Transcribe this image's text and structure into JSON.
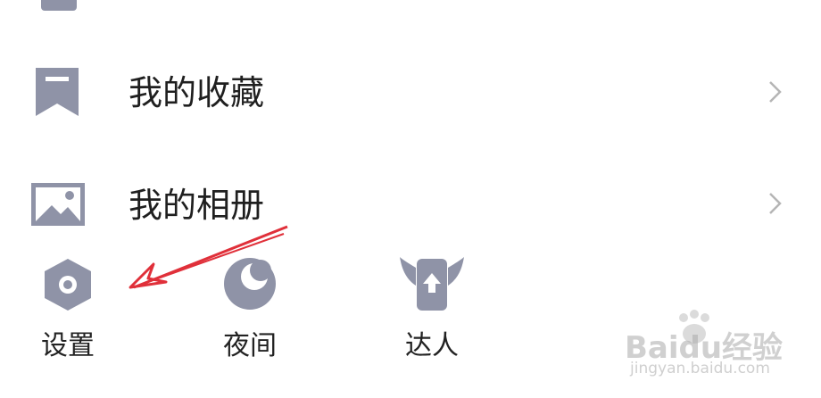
{
  "menu": {
    "items": [
      {
        "label": "我的收藏",
        "icon": "bookmark-icon"
      },
      {
        "label": "我的相册",
        "icon": "photo-album-icon"
      }
    ]
  },
  "bottom_bar": {
    "items": [
      {
        "label": "设置",
        "icon": "settings-hexagon-icon"
      },
      {
        "label": "夜间",
        "icon": "moon-icon"
      },
      {
        "label": "达人",
        "icon": "winged-badge-icon"
      }
    ]
  },
  "watermark": {
    "main": "Baidu经验",
    "sub": "jingyan.baidu.com"
  },
  "colors": {
    "icon": "#8f93a7",
    "text": "#1f1f1f",
    "chevron": "#b5b5b5",
    "annotation_arrow": "#e0303a"
  }
}
